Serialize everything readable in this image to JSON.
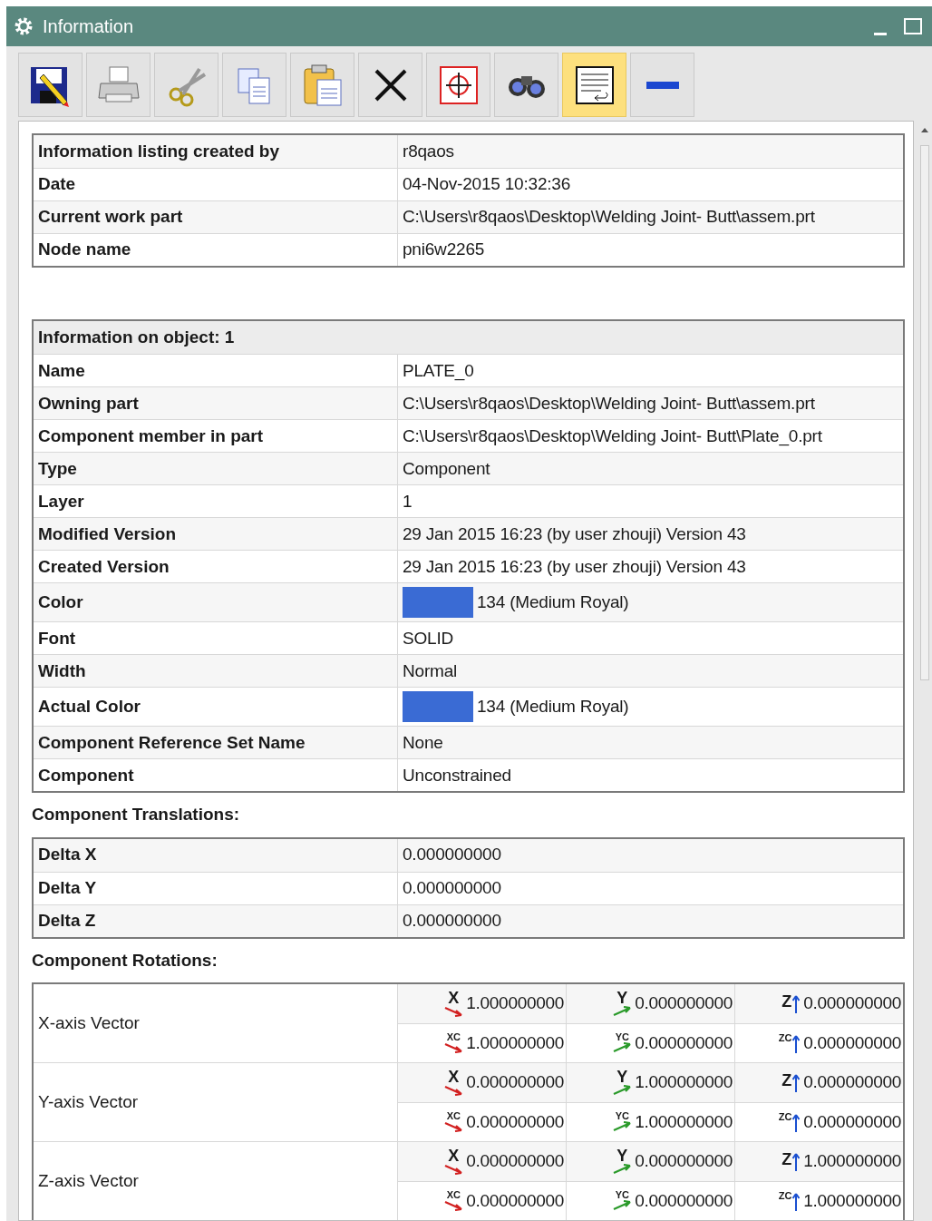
{
  "window": {
    "title": "Information"
  },
  "toolbar": [
    {
      "selected": false
    },
    {
      "selected": false
    },
    {
      "selected": false
    },
    {
      "selected": false
    },
    {
      "selected": false
    },
    {
      "selected": false
    },
    {
      "selected": false
    },
    {
      "selected": false
    },
    {
      "selected": true
    },
    {
      "selected": false
    }
  ],
  "listing": [
    {
      "label": "Information listing created by",
      "value": "r8qaos"
    },
    {
      "label": "Date",
      "value": "04-Nov-2015 10:32:36"
    },
    {
      "label": "Current work part",
      "value": "C:\\Users\\r8qaos\\Desktop\\Welding Joint- Butt\\assem.prt"
    },
    {
      "label": "Node name",
      "value": "pni6w2265"
    }
  ],
  "object": {
    "heading": "Information on object: 1",
    "rows": [
      {
        "label": "Name",
        "value": "PLATE_0"
      },
      {
        "label": "Owning part",
        "value": "C:\\Users\\r8qaos\\Desktop\\Welding Joint- Butt\\assem.prt"
      },
      {
        "label": "Component member in part",
        "value": "C:\\Users\\r8qaos\\Desktop\\Welding Joint- Butt\\Plate_0.prt"
      },
      {
        "label": "Type",
        "value": "Component"
      },
      {
        "label": "Layer",
        "value": "1"
      },
      {
        "label": "Modified Version",
        "value": "29 Jan 2015 16:23 (by user zhouji) Version 43"
      },
      {
        "label": "Created Version",
        "value": "29 Jan 2015 16:23 (by user zhouji) Version 43"
      },
      {
        "label": "Color",
        "value": "134 (Medium Royal)",
        "color": "#3a6bd4"
      },
      {
        "label": "Font",
        "value": "SOLID"
      },
      {
        "label": "Width",
        "value": "Normal"
      },
      {
        "label": "Actual Color",
        "value": "134 (Medium Royal)",
        "color": "#3a6bd4"
      },
      {
        "label": "Component Reference Set Name",
        "value": "None"
      },
      {
        "label": "Component",
        "value": "Unconstrained"
      }
    ]
  },
  "translations": {
    "heading": "Component Translations:",
    "rows": [
      {
        "label": "Delta X",
        "value": "0.000000000"
      },
      {
        "label": "Delta Y",
        "value": "0.000000000"
      },
      {
        "label": "Delta Z",
        "value": "0.000000000"
      }
    ]
  },
  "rotations": {
    "heading": "Component Rotations:",
    "vectors": [
      {
        "label": "X-axis Vector",
        "rows": [
          [
            {
              "axis": "X",
              "value": "1.000000000"
            },
            {
              "axis": "Y",
              "value": "0.000000000"
            },
            {
              "axis": "Z",
              "value": "0.000000000"
            }
          ],
          [
            {
              "axis": "XC",
              "value": "1.000000000"
            },
            {
              "axis": "YC",
              "value": "0.000000000"
            },
            {
              "axis": "ZC",
              "value": "0.000000000"
            }
          ]
        ]
      },
      {
        "label": "Y-axis Vector",
        "rows": [
          [
            {
              "axis": "X",
              "value": "0.000000000"
            },
            {
              "axis": "Y",
              "value": "1.000000000"
            },
            {
              "axis": "Z",
              "value": "0.000000000"
            }
          ],
          [
            {
              "axis": "XC",
              "value": "0.000000000"
            },
            {
              "axis": "YC",
              "value": "1.000000000"
            },
            {
              "axis": "ZC",
              "value": "0.000000000"
            }
          ]
        ]
      },
      {
        "label": "Z-axis Vector",
        "rows": [
          [
            {
              "axis": "X",
              "value": "0.000000000"
            },
            {
              "axis": "Y",
              "value": "0.000000000"
            },
            {
              "axis": "Z",
              "value": "1.000000000"
            }
          ],
          [
            {
              "axis": "XC",
              "value": "0.000000000"
            },
            {
              "axis": "YC",
              "value": "0.000000000"
            },
            {
              "axis": "ZC",
              "value": "1.000000000"
            }
          ]
        ]
      }
    ]
  }
}
